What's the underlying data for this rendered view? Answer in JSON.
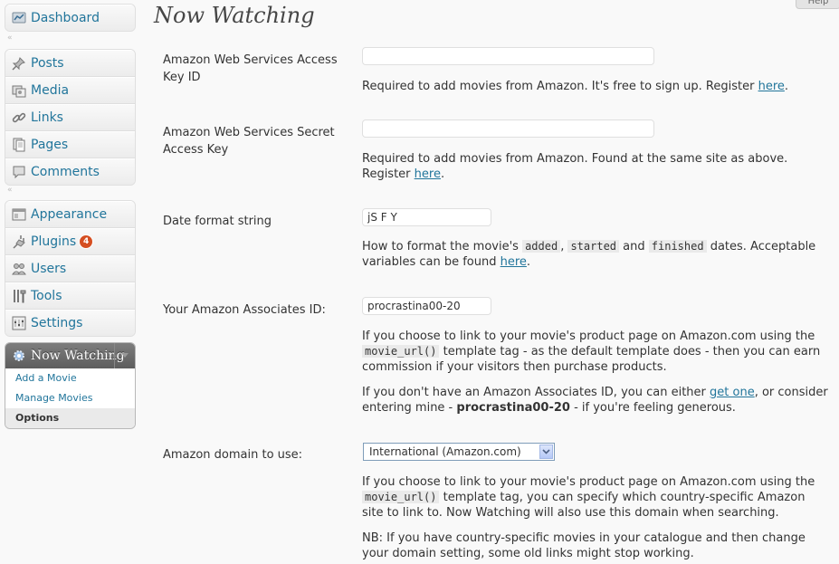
{
  "help_tab": "Help",
  "sidebar": {
    "dashboard": "Dashboard",
    "posts": "Posts",
    "media": "Media",
    "links": "Links",
    "pages": "Pages",
    "comments": "Comments",
    "appearance": "Appearance",
    "plugins": "Plugins",
    "plugins_badge": "4",
    "users": "Users",
    "tools": "Tools",
    "settings": "Settings",
    "now_watching": "Now Watching",
    "sub_add": "Add a Movie",
    "sub_manage": "Manage Movies",
    "sub_options": "Options",
    "separator_glyph": "«"
  },
  "page": {
    "title": "Now Watching"
  },
  "form": {
    "aws_key": {
      "label": "Amazon Web Services Access Key ID",
      "value": "",
      "desc_prefix": "Required to add movies from Amazon. It's free to sign up. Register ",
      "link": "here",
      "desc_suffix": "."
    },
    "aws_secret": {
      "label": "Amazon Web Services Secret Access Key",
      "value": "",
      "desc_prefix": "Required to add movies from Amazon. Found at the same site as above. Register ",
      "link": "here",
      "desc_suffix": "."
    },
    "date_format": {
      "label": "Date format string",
      "value": "jS F Y",
      "desc_1": "How to format the movie's ",
      "code_1": "added",
      "sep_1": ", ",
      "code_2": "started",
      "desc_2": " and ",
      "code_3": "finished",
      "desc_3": " dates. Acceptable variables can be found ",
      "link": "here",
      "desc_4": "."
    },
    "associates": {
      "label": "Your Amazon Associates ID:",
      "value": "procrastina00-20",
      "p1_a": "If you choose to link to your movie's product page on Amazon.com using the ",
      "p1_code": "movie_url()",
      "p1_b": " template tag - as the default template does - then you can earn commission if your visitors then purchase products.",
      "p2_a": "If you don't have an Amazon Associates ID, you can either ",
      "p2_link": "get one",
      "p2_b": ", or consider entering mine - ",
      "p2_bold": "procrastina00-20",
      "p2_c": " - if you're feeling generous."
    },
    "domain": {
      "label": "Amazon domain to use:",
      "selected": "International (Amazon.com)",
      "p1_a": "If you choose to link to your movie's product page on Amazon.com using the ",
      "p1_code": "movie_url()",
      "p1_b": " template tag, you can specify which country-specific Amazon site to link to. Now Watching will also use this domain when searching.",
      "p2": "NB: If you have country-specific movies in your catalogue and then change your domain setting, some old links might stop working."
    }
  },
  "colors": {
    "link": "#21759b",
    "badge": "#d54e21",
    "nw_header": "#6d6d6d"
  }
}
